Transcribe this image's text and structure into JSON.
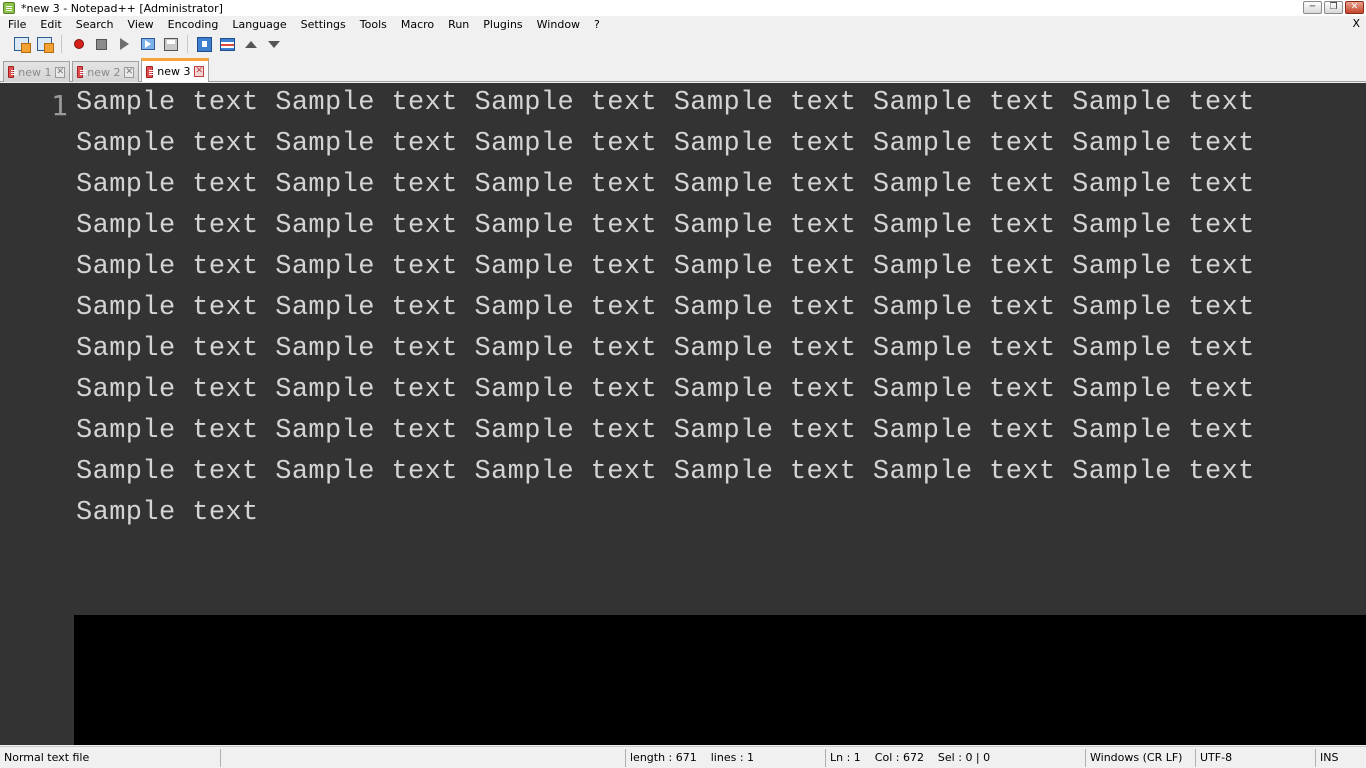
{
  "window": {
    "title": "*new 3 - Notepad++ [Administrator]",
    "controls": {
      "minimize": "─",
      "restore": "❐",
      "close": "✕"
    }
  },
  "menubar": {
    "items": [
      "File",
      "Edit",
      "Search",
      "View",
      "Encoding",
      "Language",
      "Settings",
      "Tools",
      "Macro",
      "Run",
      "Plugins",
      "Window",
      "?"
    ],
    "close_label": "X"
  },
  "toolbar": {
    "icons": [
      "close-file-icon",
      "close-all-icon",
      "record-macro-icon",
      "stop-recording-icon",
      "playback-icon",
      "run-macro-multiple-icon",
      "save-macro-icon",
      "document-monitor-icon",
      "function-list-icon",
      "find-previous-icon",
      "find-next-icon"
    ]
  },
  "tabs": [
    {
      "label": "new 1",
      "active": false,
      "close": "✕"
    },
    {
      "label": "new 2",
      "active": false,
      "close": "✕"
    },
    {
      "label": "new 3",
      "active": true,
      "close": "✕"
    }
  ],
  "editor": {
    "line_number": "1",
    "content": "Sample text Sample text Sample text Sample text Sample text Sample text Sample text Sample text Sample text Sample text Sample text Sample text Sample text Sample text Sample text Sample text Sample text Sample text Sample text Sample text Sample text Sample text Sample text Sample text Sample text Sample text Sample text Sample text Sample text Sample text Sample text Sample text Sample text Sample text Sample text Sample text Sample text Sample text Sample text Sample text Sample text Sample text Sample text Sample text Sample text Sample text Sample text Sample text Sample text Sample text Sample text Sample text Sample text Sample text Sample text Sample text Sample text Sample text Sample text Sample text Sample text",
    "colors": {
      "background": "#333333",
      "text": "#d4d4d4",
      "gutter": "#333333",
      "empty_area": "#000000"
    }
  },
  "statusbar": {
    "file_type": "Normal text file",
    "length_lines": "length : 671    lines : 1",
    "position": "Ln : 1    Col : 672    Sel : 0 | 0",
    "eol": "Windows (CR LF)",
    "encoding": "UTF-8",
    "mode": "INS"
  },
  "accent_color": "#f7a23a"
}
